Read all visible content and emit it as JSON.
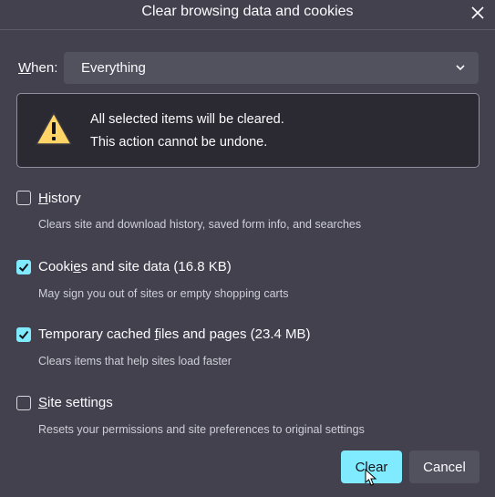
{
  "dialog": {
    "title": "Clear browsing data and cookies",
    "close_icon": "close-icon"
  },
  "when": {
    "label_prefix": "",
    "label_access": "W",
    "label_rest": "hen:",
    "selected": "Everything",
    "chevron_icon": "chevron-down-icon"
  },
  "warning": {
    "icon": "warning-triangle-icon",
    "line1": "All selected items will be cleared.",
    "line2": "This action cannot be undone."
  },
  "options": [
    {
      "checked": false,
      "label_pre": "",
      "label_access": "H",
      "label_post": "istory",
      "description": "Clears site and download history, saved form info, and searches"
    },
    {
      "checked": true,
      "label_pre": "Cooki",
      "label_access": "e",
      "label_post": "s and site data (16.8 KB)",
      "description": "May sign you out of sites or empty shopping carts"
    },
    {
      "checked": true,
      "label_pre": "Temporary cached ",
      "label_access": "f",
      "label_post": "iles and pages (23.4 MB)",
      "description": "Clears items that help sites load faster"
    },
    {
      "checked": false,
      "label_pre": "",
      "label_access": "S",
      "label_post": "ite settings",
      "description": "Resets your permissions and site preferences to original settings"
    }
  ],
  "buttons": {
    "clear_label": "Clear",
    "cancel_label": "Cancel"
  },
  "colors": {
    "background": "#42414d",
    "accent": "#80ebff",
    "warning_bg": "#2b2a33",
    "select_bg": "#52515e"
  }
}
